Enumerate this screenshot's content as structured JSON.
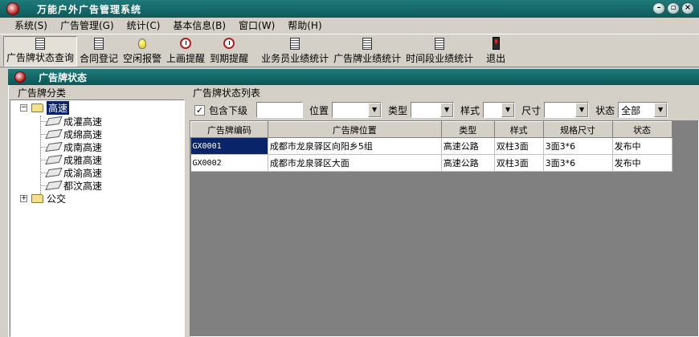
{
  "app": {
    "title": "万能户外广告管理系统"
  },
  "menu": [
    "系统(S)",
    "广告管理(G)",
    "统计(C)",
    "基本信息(B)",
    "窗口(W)",
    "帮助(H)"
  ],
  "toolbar": [
    {
      "label": "广告牌状态查询",
      "icon": "document-icon"
    },
    {
      "label": "合同登记",
      "icon": "document-icon"
    },
    {
      "label": "空闲报警",
      "icon": "bulb-icon"
    },
    {
      "label": "上画提醒",
      "icon": "alarm-clock-icon"
    },
    {
      "label": "到期提醒",
      "icon": "alarm-clock-icon"
    },
    {
      "label": "业务员业绩统计",
      "icon": "document-icon"
    },
    {
      "label": "广告牌业绩统计",
      "icon": "document-icon"
    },
    {
      "label": "时间段业绩统计",
      "icon": "document-icon"
    },
    {
      "label": "退出",
      "icon": "exit-icon"
    }
  ],
  "panel": {
    "title": "广告牌状态",
    "tree_caption": "广告牌分类",
    "list_caption": "广告牌状态列表"
  },
  "tree": {
    "root1": {
      "label": "高速",
      "expander": "−",
      "children": [
        "成灌高速",
        "成绵高速",
        "成南高速",
        "成雅高速",
        "成渝高速",
        "都汶高速"
      ]
    },
    "root2": {
      "label": "公交",
      "expander": "+"
    }
  },
  "filters": {
    "include_sub_label": "包含下级",
    "include_sub_checked": "✓",
    "keyword_value": "",
    "location_label": "位置",
    "type_label": "类型",
    "style_label": "样式",
    "size_label": "尺寸",
    "status_label": "状态",
    "status_value": "全部"
  },
  "grid": {
    "columns": [
      "广告牌编码",
      "广告牌位置",
      "类型",
      "样式",
      "规格尺寸",
      "状态"
    ],
    "rows": [
      [
        "GX0001",
        "成都市龙泉驿区向阳乡5组",
        "高速公路",
        "双柱3面",
        "3面3*6",
        "发布中"
      ],
      [
        "GX0002",
        "成都市龙泉驿区大面",
        "高速公路",
        "双柱3面",
        "3面3*6",
        "发布中"
      ]
    ]
  },
  "colors": {
    "title_bar": "#0e5a5a",
    "selection": "#0a246a"
  }
}
